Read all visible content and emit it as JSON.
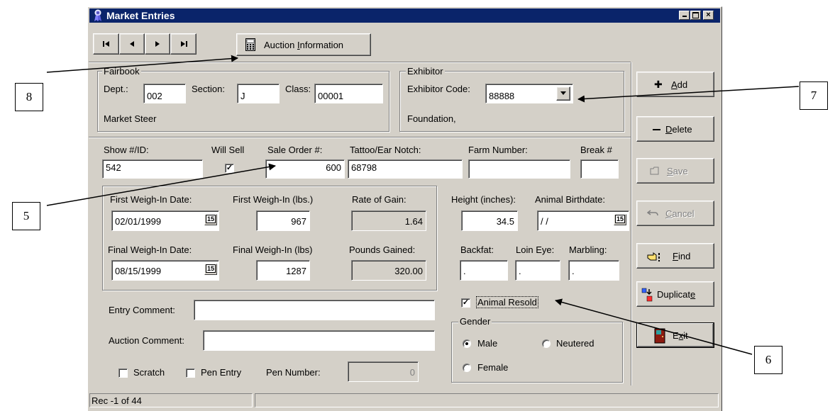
{
  "window": {
    "title": "Market Entries"
  },
  "toolbar": {
    "nav": [
      "|◄",
      "◄",
      "►",
      "►|"
    ],
    "auction_pre": "Auction ",
    "auction_u": "I",
    "auction_post": "nformation"
  },
  "fairbook": {
    "title": "Fairbook",
    "dept_label": "Dept.:",
    "dept_value": "002",
    "section_label": "Section:",
    "section_value": "J",
    "class_label": "Class:",
    "class_value": "00001",
    "class_name": "Market Steer"
  },
  "exhibitor": {
    "title": "Exhibitor",
    "code_label": "Exhibitor Code:",
    "code_value": "88888",
    "name": "Foundation,"
  },
  "row1": {
    "show_label": "Show #/ID:",
    "show_value": "542",
    "willsell_label": "Will Sell",
    "willsell_checked": true,
    "saleorder_label": "Sale Order #:",
    "saleorder_value": "600",
    "tattoo_label": "Tattoo/Ear Notch:",
    "tattoo_value": "68798",
    "farm_label": "Farm Number:",
    "farm_value": "",
    "break_label": "Break #",
    "break_value": ""
  },
  "weigh": {
    "first_date_label": "First Weigh-In Date:",
    "first_date": "02/01/1999",
    "first_lbs_label": "First Weigh-In (lbs.)",
    "first_lbs": "967",
    "rog_label": "Rate of Gain:",
    "rog": "1.64",
    "final_date_label": "Final Weigh-In Date:",
    "final_date": "08/15/1999",
    "final_lbs_label": "Final Weigh-In (lbs)",
    "final_lbs": "1287",
    "gained_label": "Pounds Gained:",
    "gained": "320.00",
    "cal_icon": "15"
  },
  "measures": {
    "height_label": "Height (inches):",
    "height": "34.5",
    "birth_label": "Animal Birthdate:",
    "birth": " / /",
    "backfat_label": "Backfat:",
    "backfat": ".",
    "loin_label": "Loin Eye:",
    "loin": ".",
    "marbling_label": "Marbling:",
    "marbling": "."
  },
  "comments": {
    "entry_label": "Entry Comment:",
    "entry_value": "",
    "auction_label": "Auction Comment:",
    "auction_value": ""
  },
  "flags": {
    "scratch_label": "Scratch",
    "pen_entry_label": "Pen Entry",
    "pen_number_label": "Pen Number:",
    "pen_number": "0",
    "resold_label": "Animal Resold",
    "resold_checked": true
  },
  "gender": {
    "title": "Gender",
    "male": "Male",
    "neutered": "Neutered",
    "female": "Female",
    "selected": "Male"
  },
  "side_buttons": {
    "add_u": "A",
    "add_rest": "dd",
    "delete_u": "D",
    "delete_rest": "elete",
    "save_u": "S",
    "save_rest": "ave",
    "cancel_u": "C",
    "cancel_rest": "ancel",
    "find_u": "F",
    "find_rest": "ind",
    "dup_pre": "Duplicat",
    "dup_u": "e",
    "exit_pre": "E",
    "exit_u": "x",
    "exit_post": "it"
  },
  "status": {
    "record": "Rec -1 of 44"
  },
  "callouts": {
    "c8": "8",
    "c7": "7",
    "c5": "5",
    "c6": "6"
  },
  "colors": {
    "titlebar": "#0a246a",
    "face": "#d4d0c8",
    "exit_door": "#8b1a10"
  }
}
